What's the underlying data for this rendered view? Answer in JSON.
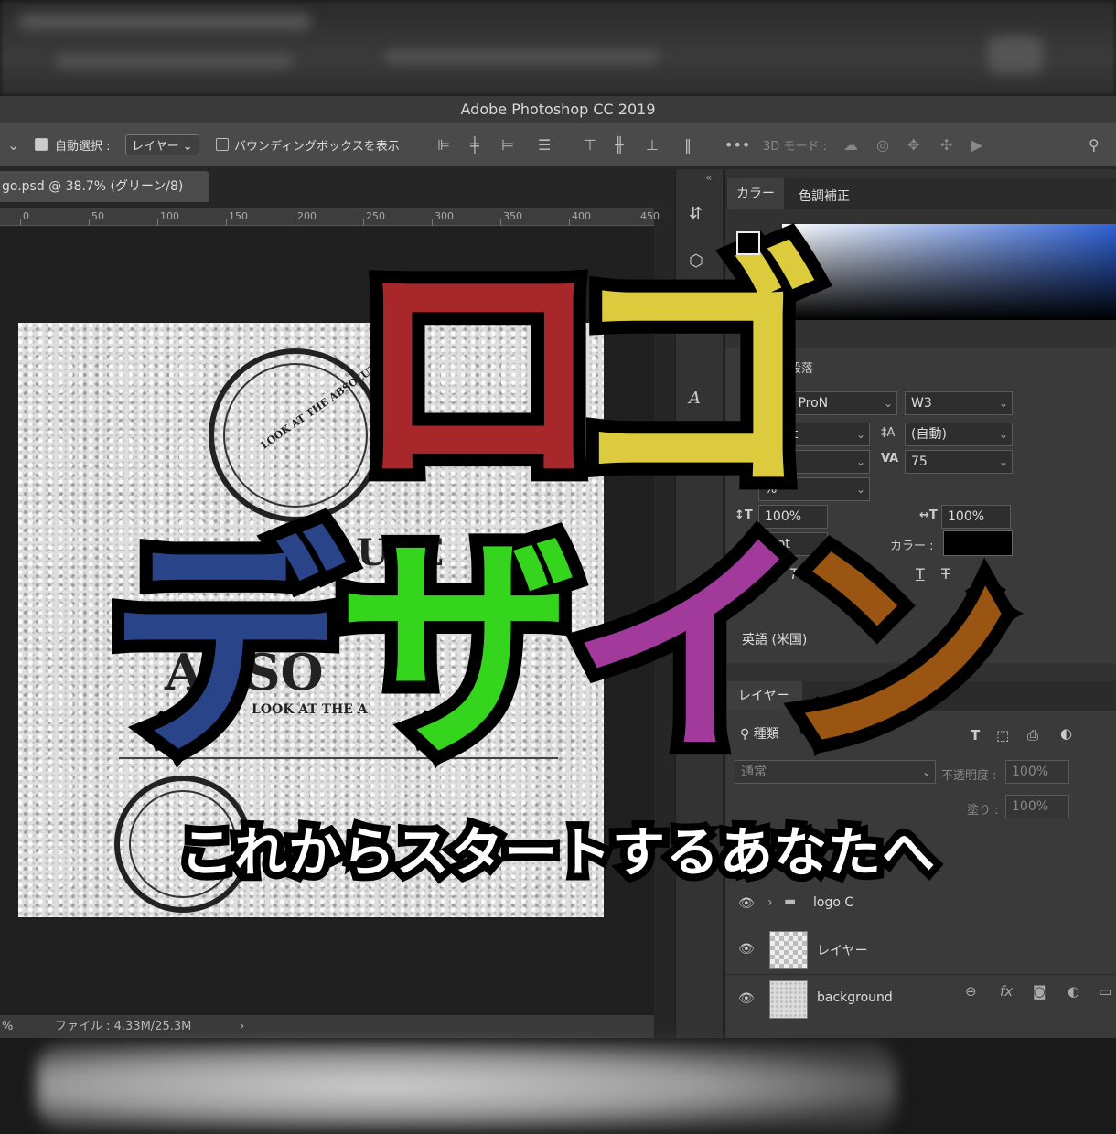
{
  "window": {
    "title": "Adobe Photoshop CC 2019"
  },
  "options_bar": {
    "auto_select_label": "自動選択 :",
    "auto_select_value": "レイヤー",
    "bounding_box_label": "バウンディングボックスを表示",
    "mode_3d_label": "3D モード :"
  },
  "document": {
    "tab_label": "go.psd @ 38.7% (グリーン/8)",
    "ruler_ticks": [
      "0",
      "50",
      "100",
      "150",
      "200",
      "250",
      "300",
      "350",
      "400",
      "450"
    ],
    "paper_text_1": "LOOK AT THE ABSOLUTE VALUE",
    "paper_text_2": "UTE",
    "paper_text_3": "ABSO",
    "paper_text_4": "LOOK AT THE A",
    "status_zoom": "%",
    "status_file": "ファイル : 4.33M/25.3M"
  },
  "color_panel": {
    "tabs": [
      "カラー",
      "色調補正"
    ]
  },
  "character_panel": {
    "tab_paragraph": "段落",
    "font_family": "角ゴ ProN",
    "font_weight": "W3",
    "font_size": "pt",
    "leading": "(自動)",
    "tracking": "75",
    "kerning": "%",
    "vertical_scale": "100%",
    "horizontal_scale": "100%",
    "baseline_shift": "0 pt",
    "color_label": "カラー :",
    "language": "英語 (米国)"
  },
  "layers_panel": {
    "tab_label": "レイヤー",
    "filter_label": "種類",
    "blend_mode": "通常",
    "opacity_label": "不透明度 :",
    "opacity_value": "100%",
    "fill_label": "塗り :",
    "fill_value": "100%",
    "layers": [
      {
        "name": "logo C",
        "type": "group"
      },
      {
        "name": "レイヤー",
        "type": "layer"
      },
      {
        "name": "background",
        "type": "layer"
      }
    ]
  },
  "overlay": {
    "chars": [
      {
        "char": "ロ",
        "color": "#a8272a"
      },
      {
        "char": "ゴ",
        "color": "#dccb3c"
      },
      {
        "char": "デ",
        "color": "#2a4489"
      },
      {
        "char": "ザ",
        "color": "#35d51e"
      },
      {
        "char": "イ",
        "color": "#a23a9b"
      },
      {
        "char": "ン",
        "color": "#9a5512"
      }
    ],
    "subtitle": "これからスタートするあなたへ"
  }
}
